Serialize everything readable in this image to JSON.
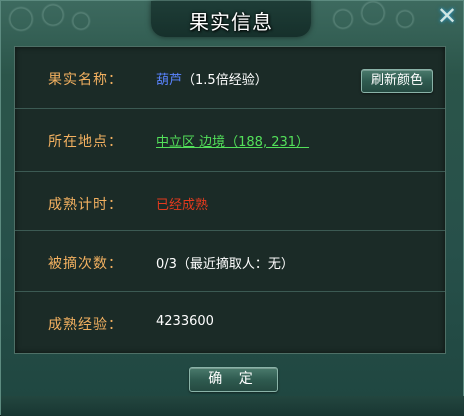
{
  "dialog": {
    "title": "果实信息",
    "close_glyph": "✕",
    "close_icon": "close-icon"
  },
  "rows": {
    "fruit_name_label": "果实名称：",
    "fruit_name": "葫芦",
    "fruit_bonus": "（1.5倍经验）",
    "refresh_button": "刷新颜色",
    "location_label": "所在地点：",
    "location_value": "中立区 边境（188, 231）",
    "ripen_time_label": "成熟计时：",
    "ripen_status": "已经成熟",
    "picked_count_label": "被摘次数：",
    "picked_count_value": "0/3（最近摘取人：无）",
    "ripe_exp_label": "成熟经验：",
    "ripe_exp_value": "4233600"
  },
  "footer": {
    "confirm_button": "确 定"
  },
  "colors": {
    "label": "#f2b060",
    "fruit_name": "#5a84ff",
    "location": "#53e05a",
    "status_ripe": "#e43a1e"
  }
}
